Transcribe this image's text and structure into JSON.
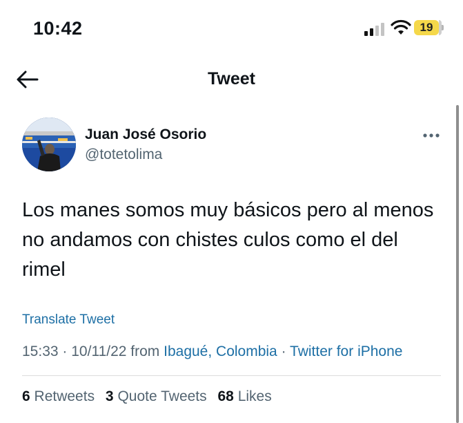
{
  "status_bar": {
    "time": "10:42",
    "battery": "19"
  },
  "header": {
    "title": "Tweet",
    "back_icon": "arrow-left-icon"
  },
  "tweet": {
    "author_name": "Juan José Osorio",
    "author_handle": "@totetolima",
    "text": "Los manes somos muy básicos pero al menos no andamos con chistes culos como el del rimel",
    "translate_label": "Translate Tweet",
    "time": "15:33",
    "date": "10/11/22",
    "from_label": "from",
    "location": "Ibagué, Colombia",
    "separator": "·",
    "source": "Twitter for iPhone",
    "stats": {
      "retweets_count": "6",
      "retweets_label": "Retweets",
      "quotes_count": "3",
      "quotes_label": "Quote Tweets",
      "likes_count": "68",
      "likes_label": "Likes"
    }
  },
  "colors": {
    "link": "#1d6fa5",
    "secondary_text": "#536471",
    "battery": "#f5d84a"
  }
}
